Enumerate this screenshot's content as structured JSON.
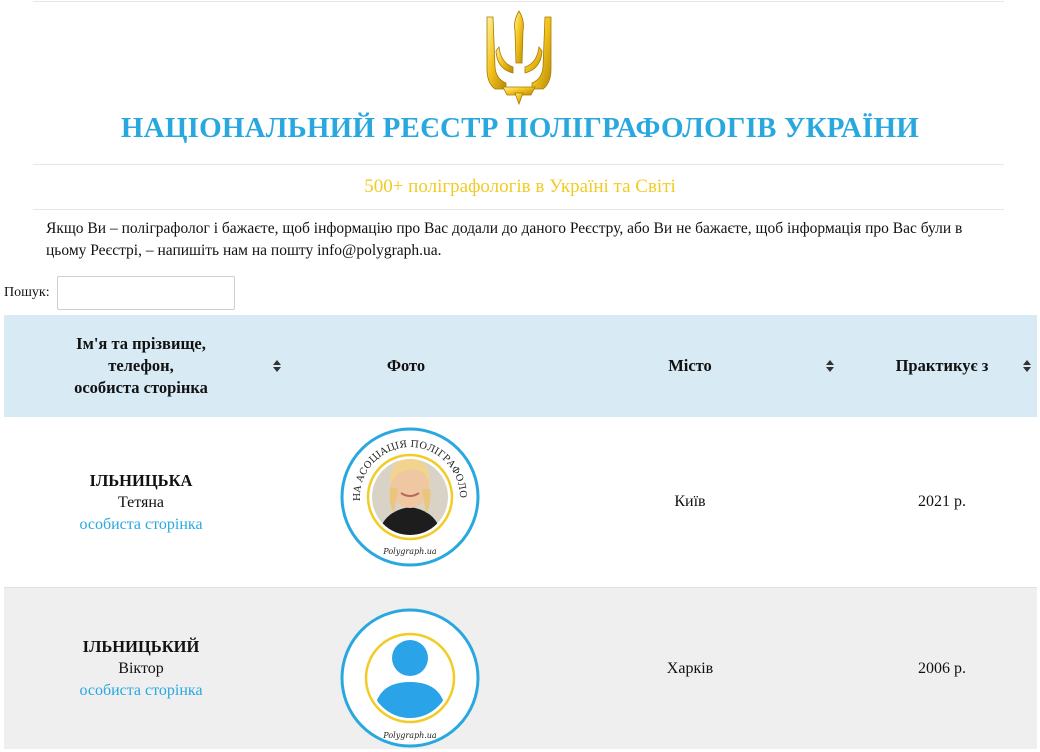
{
  "header": {
    "emblem_icon": "ukraine-trident-icon",
    "title": "НАЦІОНАЛЬНИЙ РЕЄСТР ПОЛІГРАФОЛОГІВ УКРАЇНИ",
    "subtitle": "500+ поліграфологів в Україні та Світі",
    "intro_text": "Якщо Ви – поліграфолог і бажаєте, щоб інформацію про Вас додали до даного Реєстру, або Ви не бажаєте, щоб інформація про Вас були в цьому Реєстрі, – напишіть нам на пошту info@polygraph.ua."
  },
  "search": {
    "label": "Пошук:",
    "value": "",
    "placeholder": ""
  },
  "table": {
    "columns": [
      {
        "line1": "Ім'я та прізвище,",
        "line2": "телефон,",
        "line3": "особиста сторінка",
        "sortable": true
      },
      {
        "label": "Фото",
        "sortable": false
      },
      {
        "label": "Місто",
        "sortable": true
      },
      {
        "label": "Практикує з",
        "sortable": true
      }
    ],
    "rows": [
      {
        "surname": "ІЛЬНИЦЬКА",
        "first_name": "Тетяна",
        "link": "особиста сторінка",
        "photo": "portrait-photo",
        "city": "Київ",
        "since": "2021 р."
      },
      {
        "surname": "ІЛЬНИЦЬКИЙ",
        "first_name": "Віктор",
        "link": "особиста сторінка",
        "photo": "avatar-placeholder-icon",
        "city": "Харків",
        "since": "2006 р."
      }
    ],
    "badge_text_top": "НАЦІОНАЛЬНА АСОЦІАЦІЯ ПОЛІГРАФОЛОГІВ УКРАЇНИ",
    "badge_text_bottom": "Polygraph.ua"
  },
  "colors": {
    "title": "#29a8e0",
    "subtitle": "#f2cb25",
    "header_bg": "#d8ebf5",
    "link": "#29a8e0",
    "alt_row_bg": "#efefef",
    "badge_ring": "#29a8e0",
    "badge_inner_ring": "#f2cb25"
  }
}
